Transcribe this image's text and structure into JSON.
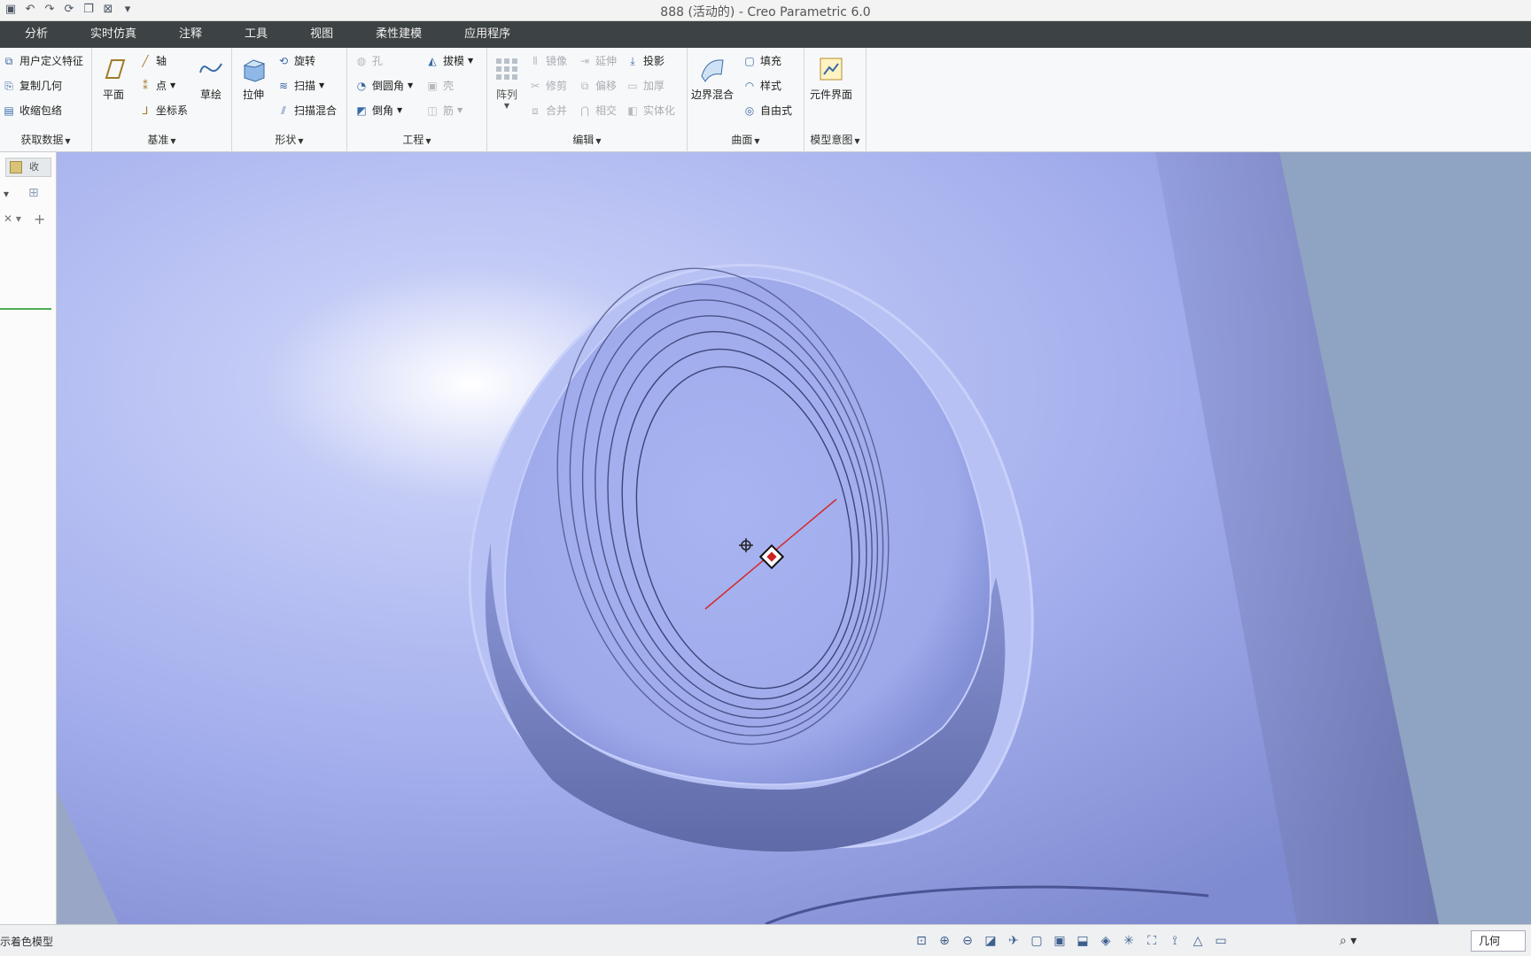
{
  "window": {
    "title": "888 (活动的) - Creo Parametric 6.0"
  },
  "quick_access": [
    {
      "icon": "save-icon",
      "glyph": "💾"
    },
    {
      "icon": "undo-icon",
      "glyph": "↶"
    },
    {
      "icon": "redo-icon",
      "glyph": "↷"
    },
    {
      "icon": "regenerate-icon",
      "glyph": "⟳"
    },
    {
      "icon": "window-icon",
      "glyph": "❐"
    },
    {
      "icon": "close-window-icon",
      "glyph": "⊠"
    },
    {
      "icon": "customize-icon",
      "glyph": "▾"
    }
  ],
  "menu": [
    "分析",
    "实时仿真",
    "注释",
    "工具",
    "视图",
    "柔性建模",
    "应用程序"
  ],
  "ribbon": {
    "get_data": {
      "label": "获取数据",
      "items": [
        "用户定义特征",
        "复制几何",
        "收缩包络"
      ]
    },
    "datum": {
      "label": "基准",
      "plane": "平面",
      "axis": "轴",
      "point": "点",
      "csys": "坐标系",
      "sketch": "草绘"
    },
    "shape": {
      "label": "形状",
      "extrude": "拉伸",
      "revolve": "旋转",
      "sweep": "扫描",
      "swept_blend": "扫描混合"
    },
    "engineering": {
      "label": "工程",
      "hole": "孔",
      "round": "倒圆角",
      "chamfer": "倒角",
      "draft": "拔模",
      "shell": "壳",
      "rib": "筋"
    },
    "editing": {
      "label": "编辑",
      "pattern": "阵列",
      "mirror": "镜像",
      "extend": "延伸",
      "project": "投影",
      "trim": "修剪",
      "offset": "偏移",
      "thicken": "加厚",
      "merge": "合并",
      "intersect": "相交",
      "solidify": "实体化"
    },
    "surfaces": {
      "label": "曲面",
      "boundary_blend": "边界混合",
      "fill": "填充",
      "style": "样式",
      "freestyle": "自由式"
    },
    "model_intent": {
      "label": "模型意图",
      "component_interface": "元件界面"
    }
  },
  "left_panel": {
    "tab_label": "收"
  },
  "status": {
    "message": "示着色模型",
    "filter": "几何"
  },
  "colors": {
    "model": "#9aa6ec",
    "background_light": "#aeb8ef",
    "accent_red": "#cc2222"
  }
}
